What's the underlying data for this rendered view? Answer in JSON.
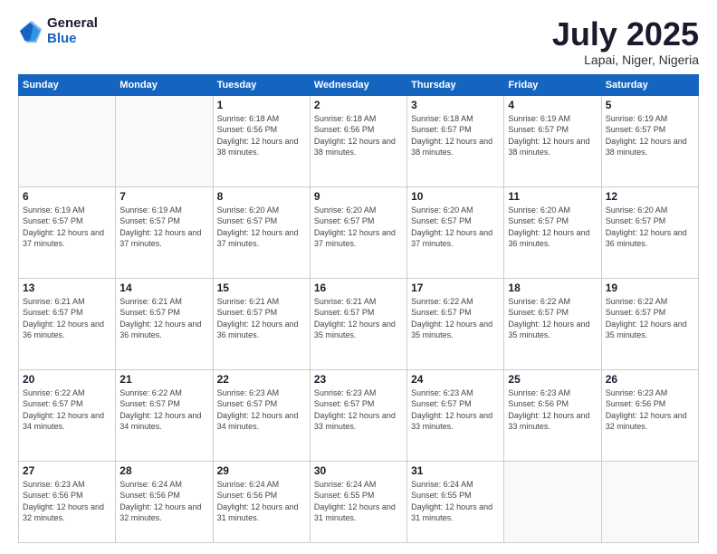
{
  "logo": {
    "general": "General",
    "blue": "Blue"
  },
  "title": {
    "month": "July 2025",
    "location": "Lapai, Niger, Nigeria"
  },
  "weekdays": [
    "Sunday",
    "Monday",
    "Tuesday",
    "Wednesday",
    "Thursday",
    "Friday",
    "Saturday"
  ],
  "weeks": [
    [
      {
        "day": "",
        "sunrise": "",
        "sunset": "",
        "daylight": ""
      },
      {
        "day": "",
        "sunrise": "",
        "sunset": "",
        "daylight": ""
      },
      {
        "day": "1",
        "sunrise": "Sunrise: 6:18 AM",
        "sunset": "Sunset: 6:56 PM",
        "daylight": "Daylight: 12 hours and 38 minutes."
      },
      {
        "day": "2",
        "sunrise": "Sunrise: 6:18 AM",
        "sunset": "Sunset: 6:56 PM",
        "daylight": "Daylight: 12 hours and 38 minutes."
      },
      {
        "day": "3",
        "sunrise": "Sunrise: 6:18 AM",
        "sunset": "Sunset: 6:57 PM",
        "daylight": "Daylight: 12 hours and 38 minutes."
      },
      {
        "day": "4",
        "sunrise": "Sunrise: 6:19 AM",
        "sunset": "Sunset: 6:57 PM",
        "daylight": "Daylight: 12 hours and 38 minutes."
      },
      {
        "day": "5",
        "sunrise": "Sunrise: 6:19 AM",
        "sunset": "Sunset: 6:57 PM",
        "daylight": "Daylight: 12 hours and 38 minutes."
      }
    ],
    [
      {
        "day": "6",
        "sunrise": "Sunrise: 6:19 AM",
        "sunset": "Sunset: 6:57 PM",
        "daylight": "Daylight: 12 hours and 37 minutes."
      },
      {
        "day": "7",
        "sunrise": "Sunrise: 6:19 AM",
        "sunset": "Sunset: 6:57 PM",
        "daylight": "Daylight: 12 hours and 37 minutes."
      },
      {
        "day": "8",
        "sunrise": "Sunrise: 6:20 AM",
        "sunset": "Sunset: 6:57 PM",
        "daylight": "Daylight: 12 hours and 37 minutes."
      },
      {
        "day": "9",
        "sunrise": "Sunrise: 6:20 AM",
        "sunset": "Sunset: 6:57 PM",
        "daylight": "Daylight: 12 hours and 37 minutes."
      },
      {
        "day": "10",
        "sunrise": "Sunrise: 6:20 AM",
        "sunset": "Sunset: 6:57 PM",
        "daylight": "Daylight: 12 hours and 37 minutes."
      },
      {
        "day": "11",
        "sunrise": "Sunrise: 6:20 AM",
        "sunset": "Sunset: 6:57 PM",
        "daylight": "Daylight: 12 hours and 36 minutes."
      },
      {
        "day": "12",
        "sunrise": "Sunrise: 6:20 AM",
        "sunset": "Sunset: 6:57 PM",
        "daylight": "Daylight: 12 hours and 36 minutes."
      }
    ],
    [
      {
        "day": "13",
        "sunrise": "Sunrise: 6:21 AM",
        "sunset": "Sunset: 6:57 PM",
        "daylight": "Daylight: 12 hours and 36 minutes."
      },
      {
        "day": "14",
        "sunrise": "Sunrise: 6:21 AM",
        "sunset": "Sunset: 6:57 PM",
        "daylight": "Daylight: 12 hours and 36 minutes."
      },
      {
        "day": "15",
        "sunrise": "Sunrise: 6:21 AM",
        "sunset": "Sunset: 6:57 PM",
        "daylight": "Daylight: 12 hours and 36 minutes."
      },
      {
        "day": "16",
        "sunrise": "Sunrise: 6:21 AM",
        "sunset": "Sunset: 6:57 PM",
        "daylight": "Daylight: 12 hours and 35 minutes."
      },
      {
        "day": "17",
        "sunrise": "Sunrise: 6:22 AM",
        "sunset": "Sunset: 6:57 PM",
        "daylight": "Daylight: 12 hours and 35 minutes."
      },
      {
        "day": "18",
        "sunrise": "Sunrise: 6:22 AM",
        "sunset": "Sunset: 6:57 PM",
        "daylight": "Daylight: 12 hours and 35 minutes."
      },
      {
        "day": "19",
        "sunrise": "Sunrise: 6:22 AM",
        "sunset": "Sunset: 6:57 PM",
        "daylight": "Daylight: 12 hours and 35 minutes."
      }
    ],
    [
      {
        "day": "20",
        "sunrise": "Sunrise: 6:22 AM",
        "sunset": "Sunset: 6:57 PM",
        "daylight": "Daylight: 12 hours and 34 minutes."
      },
      {
        "day": "21",
        "sunrise": "Sunrise: 6:22 AM",
        "sunset": "Sunset: 6:57 PM",
        "daylight": "Daylight: 12 hours and 34 minutes."
      },
      {
        "day": "22",
        "sunrise": "Sunrise: 6:23 AM",
        "sunset": "Sunset: 6:57 PM",
        "daylight": "Daylight: 12 hours and 34 minutes."
      },
      {
        "day": "23",
        "sunrise": "Sunrise: 6:23 AM",
        "sunset": "Sunset: 6:57 PM",
        "daylight": "Daylight: 12 hours and 33 minutes."
      },
      {
        "day": "24",
        "sunrise": "Sunrise: 6:23 AM",
        "sunset": "Sunset: 6:57 PM",
        "daylight": "Daylight: 12 hours and 33 minutes."
      },
      {
        "day": "25",
        "sunrise": "Sunrise: 6:23 AM",
        "sunset": "Sunset: 6:56 PM",
        "daylight": "Daylight: 12 hours and 33 minutes."
      },
      {
        "day": "26",
        "sunrise": "Sunrise: 6:23 AM",
        "sunset": "Sunset: 6:56 PM",
        "daylight": "Daylight: 12 hours and 32 minutes."
      }
    ],
    [
      {
        "day": "27",
        "sunrise": "Sunrise: 6:23 AM",
        "sunset": "Sunset: 6:56 PM",
        "daylight": "Daylight: 12 hours and 32 minutes."
      },
      {
        "day": "28",
        "sunrise": "Sunrise: 6:24 AM",
        "sunset": "Sunset: 6:56 PM",
        "daylight": "Daylight: 12 hours and 32 minutes."
      },
      {
        "day": "29",
        "sunrise": "Sunrise: 6:24 AM",
        "sunset": "Sunset: 6:56 PM",
        "daylight": "Daylight: 12 hours and 31 minutes."
      },
      {
        "day": "30",
        "sunrise": "Sunrise: 6:24 AM",
        "sunset": "Sunset: 6:55 PM",
        "daylight": "Daylight: 12 hours and 31 minutes."
      },
      {
        "day": "31",
        "sunrise": "Sunrise: 6:24 AM",
        "sunset": "Sunset: 6:55 PM",
        "daylight": "Daylight: 12 hours and 31 minutes."
      },
      {
        "day": "",
        "sunrise": "",
        "sunset": "",
        "daylight": ""
      },
      {
        "day": "",
        "sunrise": "",
        "sunset": "",
        "daylight": ""
      }
    ]
  ]
}
